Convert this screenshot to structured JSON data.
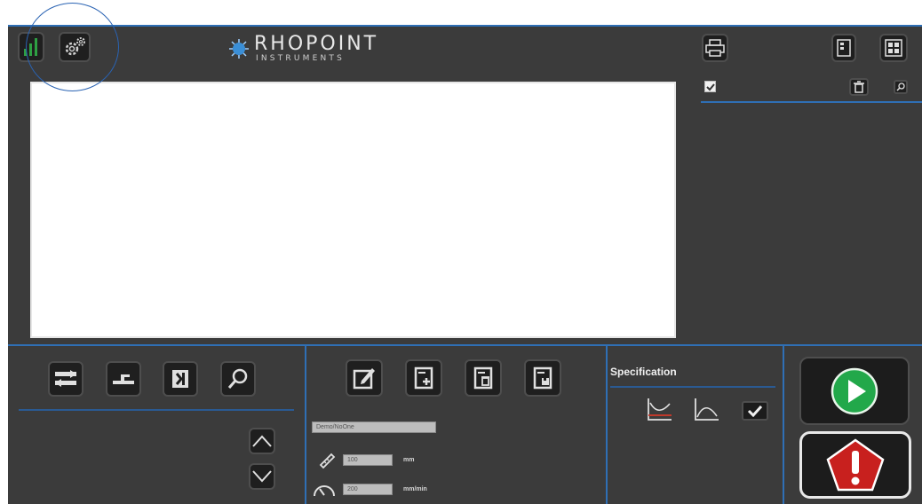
{
  "header": {
    "logo_name": "RHOPOINT",
    "logo_sub": "INSTRUMENTS"
  },
  "fields": {
    "name_value": "Demo/NoOne",
    "length_value": "100",
    "length_unit": "mm",
    "speed_value": "200",
    "speed_unit": "mm/min"
  },
  "specification": {
    "title": "Specification"
  },
  "icons": {
    "signal": "signal-icon",
    "settings": "gear-icon",
    "printer": "printer-icon",
    "layout_single": "single-layout-icon",
    "layout_grid": "grid-layout-icon",
    "delete": "trash-icon",
    "zoom_small": "zoom-icon",
    "swap": "swap-icon",
    "baseline": "baseline-icon",
    "bracket": "bracket-icon",
    "search": "search-icon",
    "edit": "edit-icon",
    "add": "add-document-icon",
    "remove": "delete-document-icon",
    "save": "save-document-icon",
    "up": "chevron-up-icon",
    "down": "chevron-down-icon",
    "ruler": "ruler-icon",
    "gauge": "gauge-icon",
    "spec_low": "spec-lower-limit-icon",
    "spec_high": "spec-upper-limit-icon",
    "play": "play-icon",
    "stop": "emergency-stop-icon"
  },
  "colors": {
    "accent": "#2f6fb5",
    "panel": "#3b3b3b",
    "button": "#1f1f1f",
    "play_green": "#22a84a",
    "stop_red": "#c8201e",
    "signal_green": "#2ea043",
    "spec_red": "#c0392b"
  }
}
